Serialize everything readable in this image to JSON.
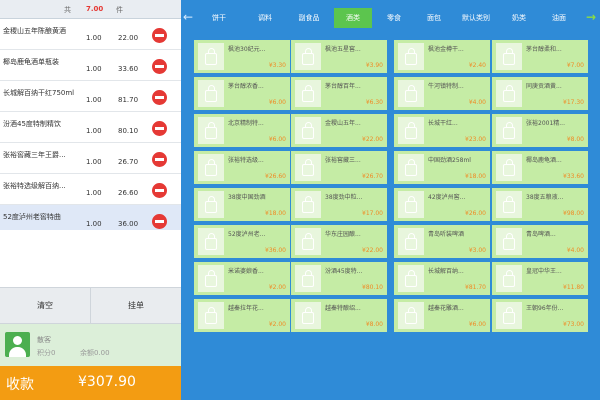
{
  "summary": {
    "label_a": "共",
    "count": "7.00",
    "label_c": "件"
  },
  "orders": [
    {
      "name": "金稷山五年陈酿黄酒",
      "qty": "1.00",
      "price": "22.00"
    },
    {
      "name": "椰岛鹿龟酒单瓶装",
      "qty": "1.00",
      "price": "33.60"
    },
    {
      "name": "长城解百纳干红750ml",
      "qty": "1.00",
      "price": "81.70"
    },
    {
      "name": "汾酒45度特制精饮",
      "qty": "1.00",
      "price": "80.10"
    },
    {
      "name": "张裕窖藏三年王爵...",
      "qty": "1.00",
      "price": "26.70"
    },
    {
      "name": "张裕特选级解百纳...",
      "qty": "1.00",
      "price": "26.60"
    },
    {
      "name": "52度泸州老窖特曲",
      "qty": "1.00",
      "price": "36.00"
    }
  ],
  "buttons": {
    "clear": "清空",
    "hold": "挂单"
  },
  "member": {
    "name": "散客",
    "points": "积分0",
    "balance": "余额0.00"
  },
  "checkout": {
    "label": "收款",
    "total": "¥307.90"
  },
  "nav": {
    "back_icon": "arrow-left-icon",
    "forward_icon": "arrow-right-icon",
    "active_color": "#5cc54e",
    "tabs": [
      "饼干",
      "调料",
      "副食品",
      "酒类",
      "零食",
      "面包",
      "默认类别",
      "奶类",
      "油面"
    ]
  },
  "products": [
    [
      {
        "name": "枫池30纪元...",
        "price": "¥3.30"
      },
      {
        "name": "枫池五星窖...",
        "price": "¥3.90"
      },
      {
        "name": "枫池金樽干...",
        "price": "¥2.40"
      },
      {
        "name": "茅台醇柔和...",
        "price": "¥7.00"
      }
    ],
    [
      {
        "name": "茅台醇浓香...",
        "price": "¥6.00"
      },
      {
        "name": "茅台醇百年...",
        "price": "¥6.30"
      },
      {
        "name": "牛河镇特制...",
        "price": "¥4.00"
      },
      {
        "name": "同庚贡酒黄...",
        "price": "¥17.30"
      }
    ],
    [
      {
        "name": "北京精制特...",
        "price": "¥6.00"
      },
      {
        "name": "金稷山五年...",
        "price": "¥22.00"
      },
      {
        "name": "长城干红...",
        "price": "¥23.00"
      },
      {
        "name": "张裕2001精...",
        "price": "¥8.00"
      }
    ],
    [
      {
        "name": "张裕特选级...",
        "price": "¥26.60"
      },
      {
        "name": "张裕窖藏三...",
        "price": "¥26.70"
      },
      {
        "name": "中国劲酒258ml",
        "price": "¥18.00"
      },
      {
        "name": "椰岛鹿龟酒...",
        "price": "¥33.60"
      }
    ],
    [
      {
        "name": "38度中国劲酒",
        "price": "¥18.00"
      },
      {
        "name": "38度劲中粒...",
        "price": "¥17.00"
      },
      {
        "name": "42度泸州窖...",
        "price": "¥26.00"
      },
      {
        "name": "38度五粮液...",
        "price": "¥98.00"
      }
    ],
    [
      {
        "name": "52度泸州老...",
        "price": "¥36.00"
      },
      {
        "name": "华东庄园酿...",
        "price": "¥22.00"
      },
      {
        "name": "青岛听装啤酒",
        "price": "¥3.00"
      },
      {
        "name": "青岛啤酒...",
        "price": "¥4.00"
      }
    ],
    [
      {
        "name": "米诺婆娘香...",
        "price": "¥2.00"
      },
      {
        "name": "汾酒45度特...",
        "price": "¥80.10"
      },
      {
        "name": "长城解百纳...",
        "price": "¥81.70"
      },
      {
        "name": "皇冠中华王...",
        "price": "¥11.80"
      }
    ],
    [
      {
        "name": "越秦拉年花...",
        "price": "¥2.00"
      },
      {
        "name": "越秦特酿绍...",
        "price": "¥8.00"
      },
      {
        "name": "越秦花雕酒...",
        "price": "¥6.00"
      },
      {
        "name": "王朝96年份...",
        "price": "¥73.00"
      }
    ]
  ]
}
